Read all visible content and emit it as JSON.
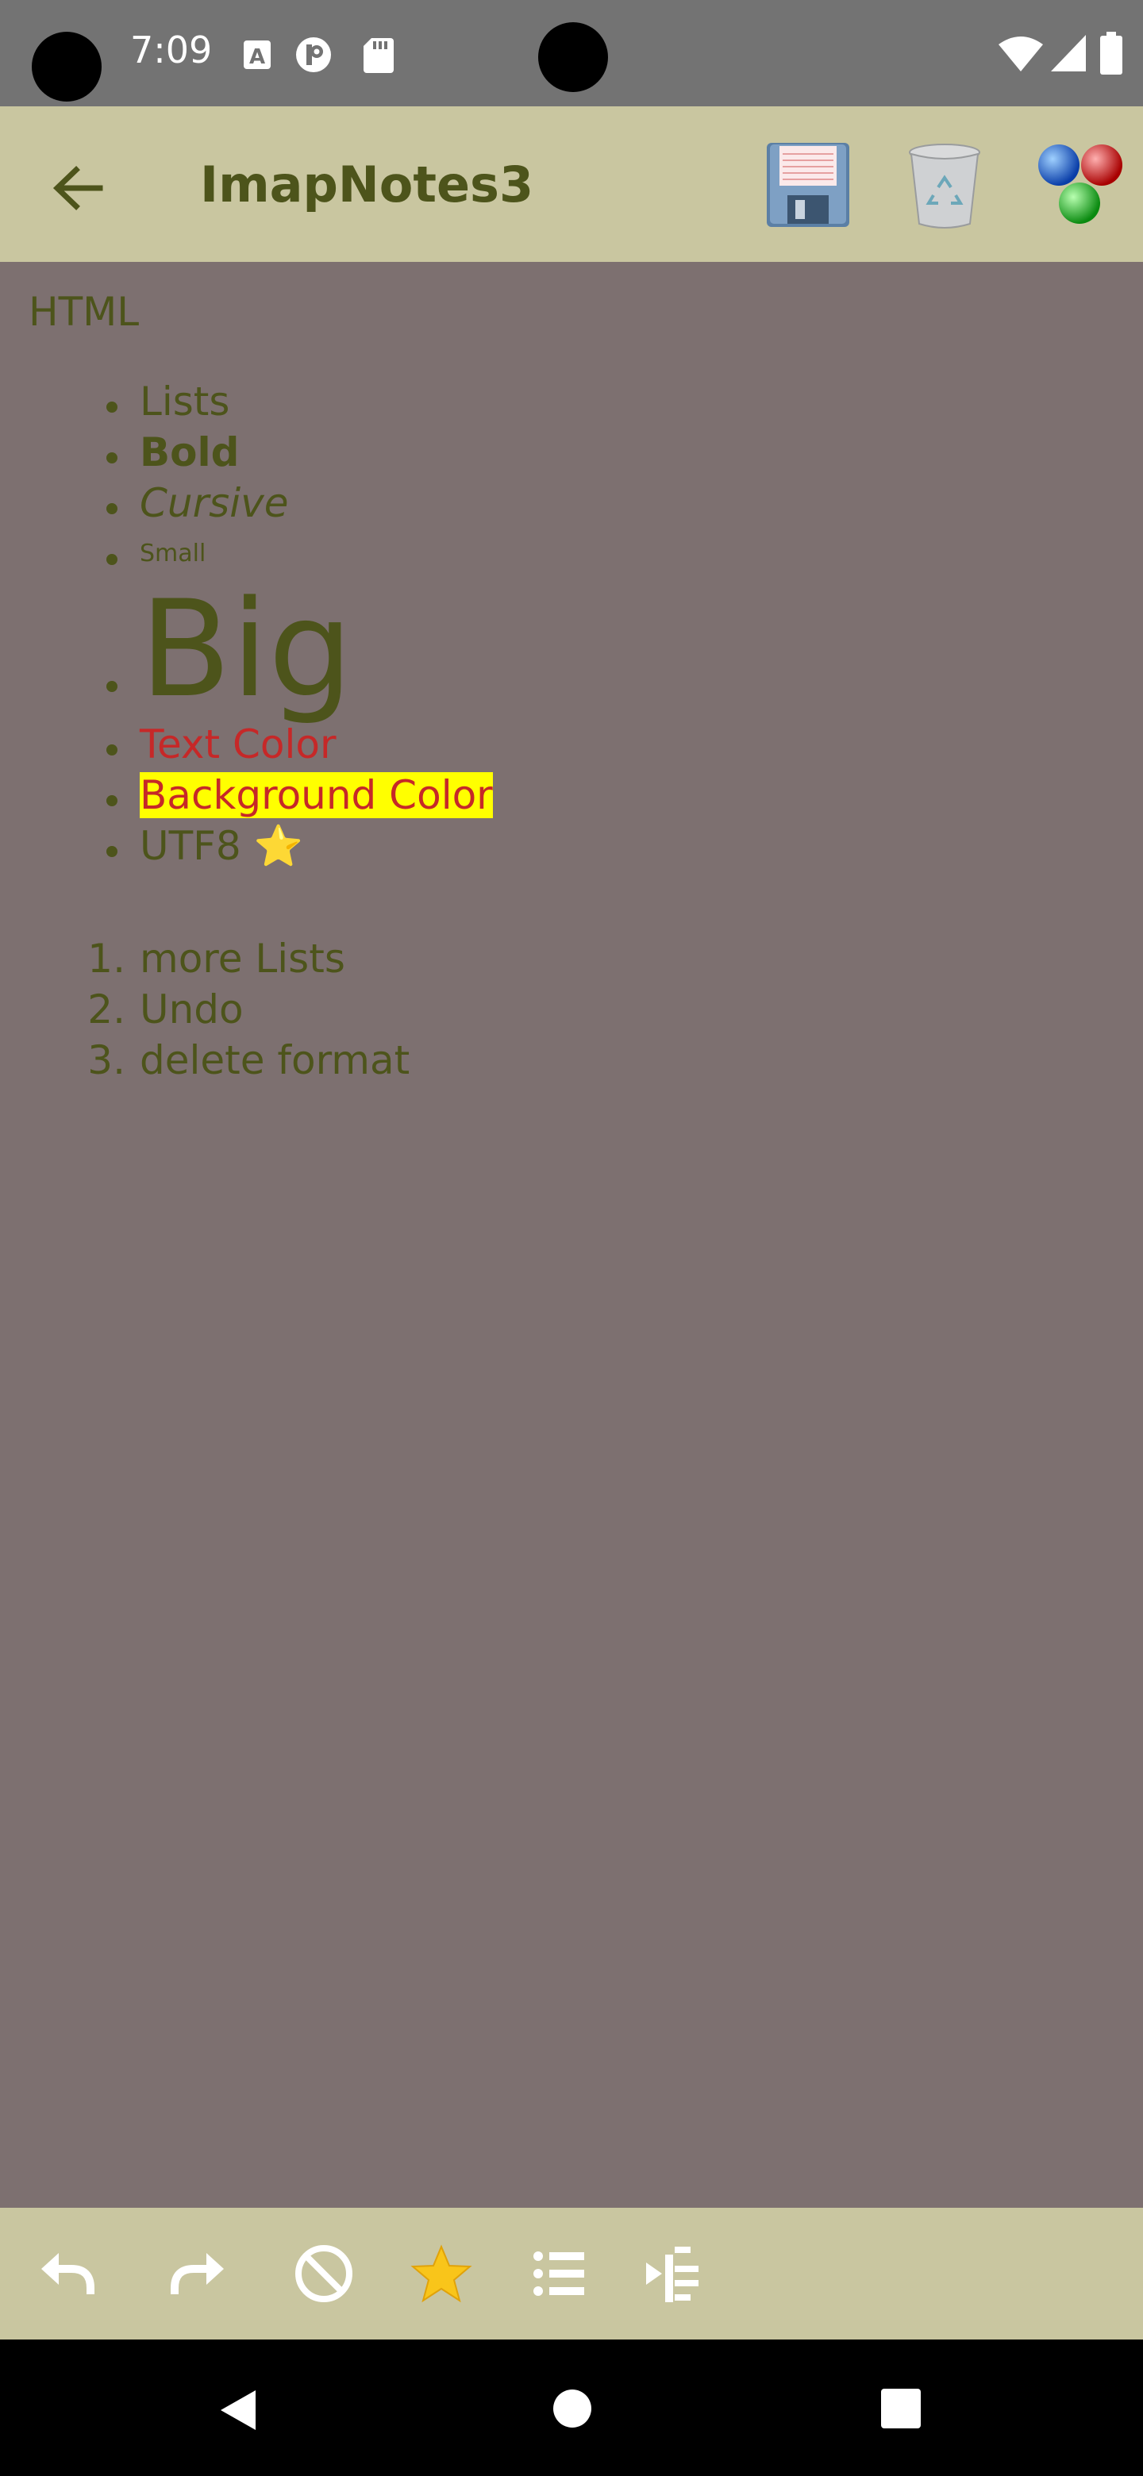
{
  "status_bar": {
    "time": "7:09"
  },
  "app_bar": {
    "title": "ImapNotes3",
    "back_icon": "arrow-left-icon",
    "actions": [
      "save-icon",
      "trash-icon",
      "color-picker-icon"
    ]
  },
  "note": {
    "heading": "HTML",
    "bullets": {
      "lists": "Lists",
      "bold": "Bold",
      "cursive": "Cursive",
      "small": "Small",
      "big": "Big",
      "text_color": "Text Color",
      "background_color": "Background Color",
      "utf8": "UTF8",
      "utf8_emoji": "⭐"
    },
    "numbered": [
      {
        "num": "1.",
        "text": "more Lists"
      },
      {
        "num": "2.",
        "text": "Undo"
      },
      {
        "num": "3.",
        "text": "delete format"
      }
    ]
  },
  "toolbar": {
    "buttons": [
      "undo-icon",
      "redo-icon",
      "clear-format-icon",
      "star-icon",
      "bullet-list-icon",
      "indent-icon"
    ]
  },
  "colors": {
    "status_bar": "#737373",
    "app_bar": "#c9c6a0",
    "content_bg": "#7d7070",
    "text": "#4d541b",
    "red_text": "#c62828",
    "highlight": "#ffff00"
  }
}
